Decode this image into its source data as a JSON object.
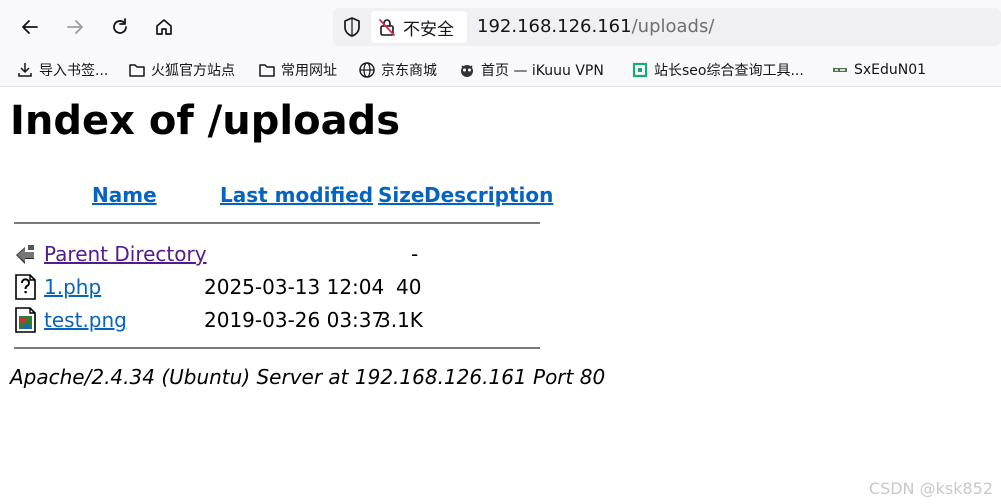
{
  "browser": {
    "security_label": "不安全",
    "url_host": "192.168.126.161",
    "url_path": "/uploads/",
    "bookmarks": [
      {
        "label": "导入书签...",
        "icon": "import-bookmarks-icon"
      },
      {
        "label": "火狐官方站点",
        "icon": "folder-icon"
      },
      {
        "label": "常用网址",
        "icon": "folder-icon"
      },
      {
        "label": "京东商城",
        "icon": "globe-icon"
      },
      {
        "label": "首页 — iKuuu VPN",
        "icon": "site-favicon"
      },
      {
        "label": "站长seo综合查询工具...",
        "icon": "site-favicon"
      },
      {
        "label": "SxEduN01",
        "icon": "site-favicon"
      }
    ]
  },
  "page": {
    "title": "Index of /uploads",
    "headers": {
      "name": "Name",
      "modified": "Last modified",
      "size": "Size",
      "description": "Description"
    },
    "rows": [
      {
        "name": "Parent Directory",
        "modified": "",
        "size": "-",
        "icon": "back-folder-icon"
      },
      {
        "name": "1.php",
        "modified": "2025-03-13 12:04",
        "size": "40",
        "icon": "unknown-file-icon"
      },
      {
        "name": "test.png",
        "modified": "2019-03-26 03:37",
        "size": "3.1K",
        "icon": "image-file-icon"
      }
    ],
    "address": "Apache/2.4.34 (Ubuntu) Server at 192.168.126.161 Port 80"
  },
  "watermark": "CSDN @ksk852"
}
